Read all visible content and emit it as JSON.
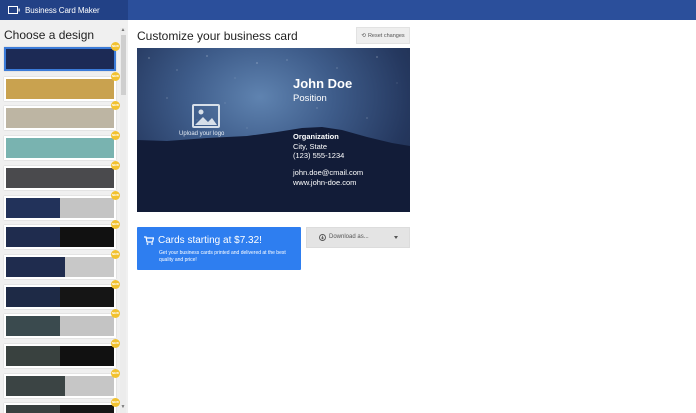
{
  "app": {
    "title": "Business Card Maker"
  },
  "sidebar": {
    "title": "Choose a design",
    "badge_label": "NEW",
    "designs": [
      {
        "name": "starry-night",
        "left": "#1c2a55",
        "right": "#1c2a55",
        "split": 1,
        "selected": true,
        "badge": true
      },
      {
        "name": "gold",
        "left": "#c9a24f",
        "right": "#c9a24f",
        "split": 1,
        "selected": false,
        "badge": true
      },
      {
        "name": "beige",
        "left": "#bdb5a3",
        "right": "#bdb5a3",
        "split": 1,
        "selected": false,
        "badge": true
      },
      {
        "name": "teal",
        "left": "#79b3b0",
        "right": "#79b3b0",
        "split": 1,
        "selected": false,
        "badge": true
      },
      {
        "name": "dark-gray",
        "left": "#4a4a4d",
        "right": "#4a4a4d",
        "split": 1,
        "selected": false,
        "badge": true
      },
      {
        "name": "stars-silver",
        "left": "#22325a",
        "right": "#c4c4c4",
        "split": 0.5,
        "selected": false,
        "badge": true
      },
      {
        "name": "stars-black",
        "left": "#1f2c4e",
        "right": "#111111",
        "split": 0.5,
        "selected": false,
        "badge": true
      },
      {
        "name": "stars-silver-strip",
        "left": "#1f2c4e",
        "right": "#c8c8c8",
        "split": 0.55,
        "selected": false,
        "badge": true
      },
      {
        "name": "stars-black-2",
        "left": "#1e2a46",
        "right": "#151515",
        "split": 0.5,
        "selected": false,
        "badge": true
      },
      {
        "name": "city-silver",
        "left": "#3a4a4e",
        "right": "#c4c4c4",
        "split": 0.5,
        "selected": false,
        "badge": true
      },
      {
        "name": "city-black",
        "left": "#39413f",
        "right": "#111111",
        "split": 0.5,
        "selected": false,
        "badge": true
      },
      {
        "name": "city-strip",
        "left": "#3b4444",
        "right": "#c6c6c6",
        "split": 0.55,
        "selected": false,
        "badge": true
      },
      {
        "name": "city-black-2",
        "left": "#384040",
        "right": "#161616",
        "split": 0.5,
        "selected": false,
        "badge": true
      }
    ]
  },
  "main": {
    "title": "Customize your business card",
    "reset_label": "Reset changes"
  },
  "card": {
    "upload_label": "Upload your logo",
    "name": "John Doe",
    "position": "Position",
    "organization": "Organization",
    "city": "City, State",
    "phone": "(123) 555-1234",
    "email": "john.doe@cmail.com",
    "website": "www.john-doe.com"
  },
  "cta": {
    "title": "Cards starting at $7.32!",
    "subtitle": "Get your business cards printed and delivered at the best quality and price!"
  },
  "download": {
    "label": "Download as..."
  },
  "colors": {
    "topbar": "#2b4f9b",
    "brand_bg": "#224186",
    "accent": "#2e7ef0",
    "badge": "#f2c230",
    "selected_border": "#3b7bd8"
  }
}
